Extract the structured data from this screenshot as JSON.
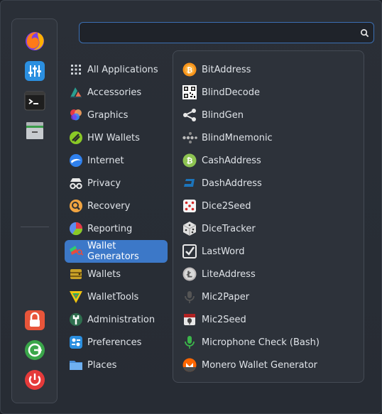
{
  "search": {
    "value": "",
    "placeholder": ""
  },
  "favorites": [
    {
      "name": "firefox-icon"
    },
    {
      "name": "settings-mixer-icon"
    },
    {
      "name": "terminal-icon"
    },
    {
      "name": "file-manager-icon"
    }
  ],
  "session": [
    {
      "name": "lock-icon"
    },
    {
      "name": "logout-icon"
    },
    {
      "name": "power-icon"
    }
  ],
  "categories": [
    {
      "label": "All Applications",
      "icon": "grid-icon"
    },
    {
      "label": "Accessories",
      "icon": "accessories-icon"
    },
    {
      "label": "Graphics",
      "icon": "graphics-icon"
    },
    {
      "label": "HW Wallets",
      "icon": "hw-wallets-icon"
    },
    {
      "label": "Internet",
      "icon": "internet-icon"
    },
    {
      "label": "Privacy",
      "icon": "privacy-icon"
    },
    {
      "label": "Recovery",
      "icon": "recovery-icon"
    },
    {
      "label": "Reporting",
      "icon": "reporting-icon"
    },
    {
      "label": "Wallet Generators",
      "icon": "wallet-generators-icon",
      "selected": true
    },
    {
      "label": "Wallets",
      "icon": "wallets-icon"
    },
    {
      "label": "WalletTools",
      "icon": "wallettools-icon"
    },
    {
      "label": "Administration",
      "icon": "administration-icon"
    },
    {
      "label": "Preferences",
      "icon": "preferences-icon"
    },
    {
      "label": "Places",
      "icon": "folder-icon"
    }
  ],
  "apps": [
    {
      "label": "BitAddress",
      "icon": "bitaddress-icon"
    },
    {
      "label": "BlindDecode",
      "icon": "qr-code-icon"
    },
    {
      "label": "BlindGen",
      "icon": "share-icon"
    },
    {
      "label": "BlindMnemonic",
      "icon": "mnemonic-icon"
    },
    {
      "label": "CashAddress",
      "icon": "bitcoin-cash-icon"
    },
    {
      "label": "DashAddress",
      "icon": "dash-icon"
    },
    {
      "label": "Dice2Seed",
      "icon": "dice-icon"
    },
    {
      "label": "DiceTracker",
      "icon": "dice-tracker-icon"
    },
    {
      "label": "LastWord",
      "icon": "checkbox-icon"
    },
    {
      "label": "LiteAddress",
      "icon": "litecoin-icon"
    },
    {
      "label": "Mic2Paper",
      "icon": "microphone-icon"
    },
    {
      "label": "Mic2Seed",
      "icon": "mic2seed-icon"
    },
    {
      "label": "Microphone Check (Bash)",
      "icon": "microphone-check-icon"
    },
    {
      "label": "Monero Wallet Generator",
      "icon": "monero-icon"
    }
  ],
  "colors": {
    "accent": "#3c78c8",
    "background": "#2a2f37"
  }
}
